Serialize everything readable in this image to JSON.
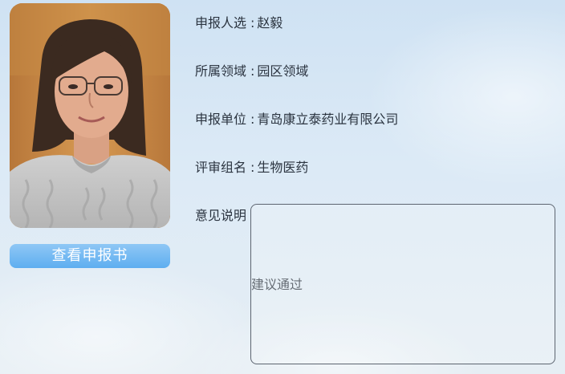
{
  "profile": {
    "view_button_label": "查看申报书"
  },
  "fields": {
    "name_label": "申报人选",
    "name_value": "赵毅",
    "domain_label": "所属领域",
    "domain_value": "园区领域",
    "unit_label": "申报单位",
    "unit_value": "青岛康立泰药业有限公司",
    "group_label": "评审组名",
    "group_value": "生物医药",
    "separator": ":"
  },
  "opinion": {
    "label": "意见说明",
    "text": "建议通过"
  },
  "colors": {
    "button": "#5eaef0",
    "background": "#dceaf6"
  }
}
